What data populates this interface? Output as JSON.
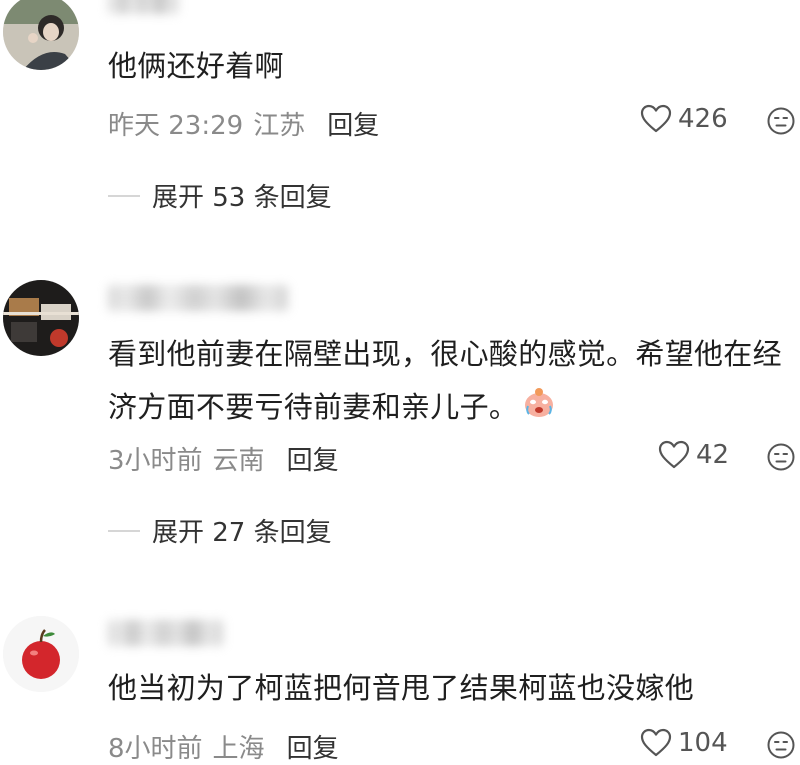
{
  "comments": [
    {
      "text": "他俩还好着啊",
      "time": "昨天 23:29",
      "location": "江苏",
      "reply_label": "回复",
      "likes": "426",
      "expand_label": "展开 53 条回复"
    },
    {
      "text": "看到他前妻在隔壁出现，很心酸的感觉。希望他在经济方面不要亏待前妻和亲儿子。",
      "time": "3小时前",
      "location": "云南",
      "reply_label": "回复",
      "likes": "42",
      "expand_label": "展开 27 条回复"
    },
    {
      "text": "他当初为了柯蓝把何音甩了结果柯蓝也没嫁他",
      "time": "8小时前",
      "location": "上海",
      "reply_label": "回复",
      "likes": "104"
    }
  ],
  "icons": {
    "like": "heart-outline-icon",
    "dislike": "unhappy-face-icon",
    "emoji": "crying-face-emoji"
  },
  "colors": {
    "meta_text": "#8a8a8a",
    "body_text": "#1f1f1f",
    "divider": "#d6d6d6"
  }
}
